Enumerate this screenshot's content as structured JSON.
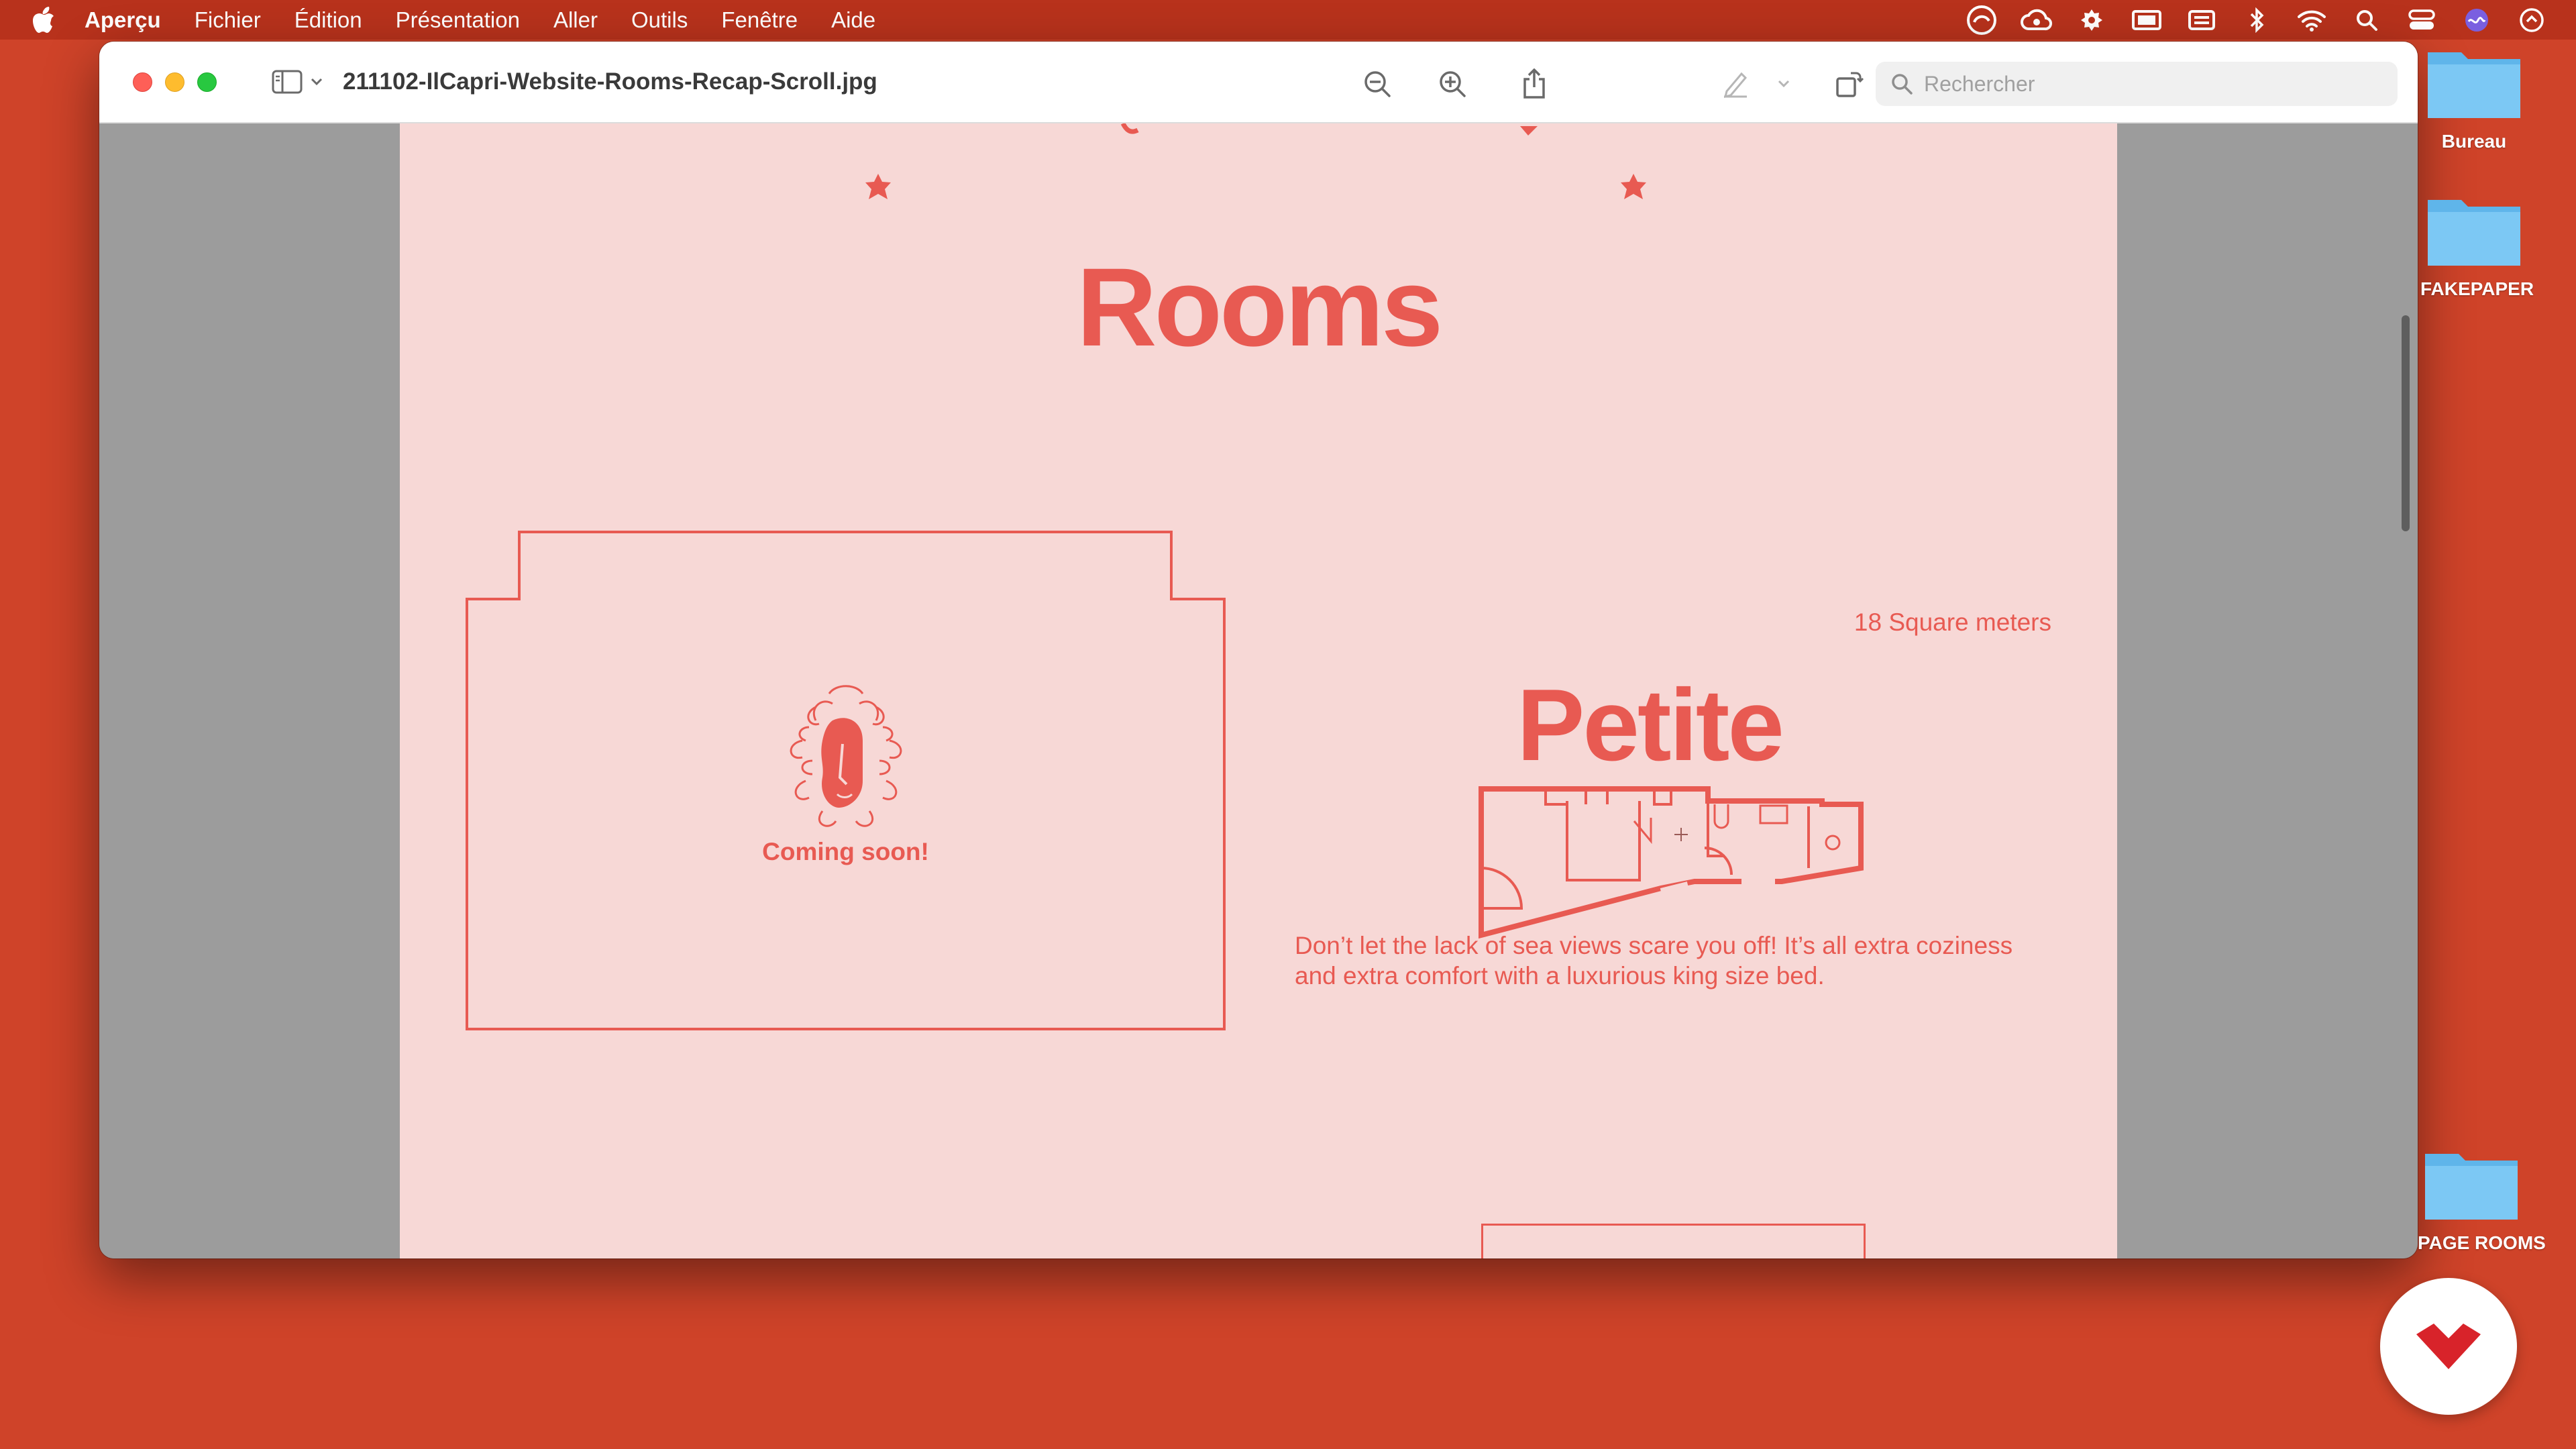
{
  "menubar": {
    "app": "Aperçu",
    "items": [
      "Fichier",
      "Édition",
      "Présentation",
      "Aller",
      "Outils",
      "Fenêtre",
      "Aide"
    ],
    "status_icons": [
      "creative-cloud-icon",
      "creative-cloud-sync-icon",
      "settings-badge-icon",
      "display-icon",
      "keyboard-icon",
      "bluetooth-icon",
      "wifi-icon",
      "spotlight-search-icon",
      "control-center-icon",
      "siri-icon",
      "clock-icon"
    ]
  },
  "window": {
    "title": "211102-IlCapri-Website-Rooms-Recap-Scroll.jpg",
    "search_placeholder": "Rechercher"
  },
  "page": {
    "heading": "Rooms",
    "card_status": "Coming soon!",
    "room": {
      "size": "18 Square meters",
      "name": "Petite",
      "description_line1": "Don’t let the lack of sea views scare you off! It’s all extra coziness",
      "description_line2": "and extra comfort with a luxurious king size bed."
    }
  },
  "desktop": {
    "folders": [
      "Bureau",
      "FAKEPAPER",
      "PAGE ROOMS"
    ]
  },
  "colors": {
    "desktop": "#cf4329",
    "menubar": "#b8321c",
    "page": "#f7d8d6",
    "accent": "#e85a52"
  }
}
